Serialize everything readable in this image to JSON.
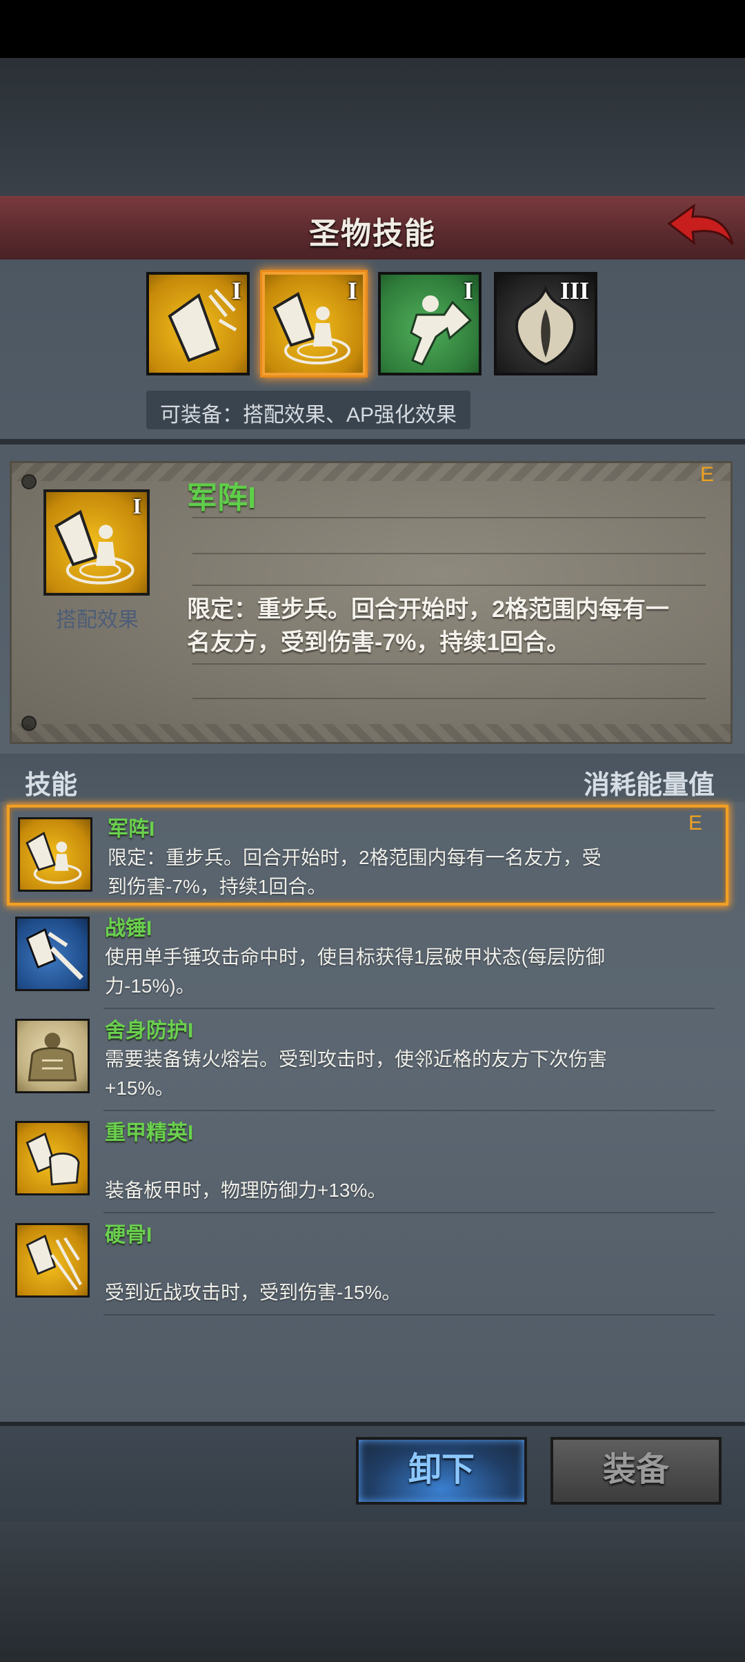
{
  "header": {
    "title": "圣物技能"
  },
  "relic_slots": [
    {
      "grade": "I",
      "color": "gold",
      "selected": false
    },
    {
      "grade": "I",
      "color": "gold",
      "selected": true
    },
    {
      "grade": "I",
      "color": "green",
      "selected": false
    },
    {
      "grade": "III",
      "color": "dark",
      "selected": false
    }
  ],
  "equip_note": "可装备：搭配效果、AP强化效果",
  "detail": {
    "grade": "I",
    "icon_label": "搭配效果",
    "title": "军阵I",
    "rank": "E",
    "description": "限定：重步兵。回合开始时，2格范围内每有一名友方，受到伤害-7%，持续1回合。"
  },
  "list_header": {
    "left": "技能",
    "right": "消耗能量值"
  },
  "skills": [
    {
      "name": "军阵I",
      "rank": "E",
      "desc": "限定：重步兵。回合开始时，2格范围内每有一名友方，受到伤害-7%，持续1回合。",
      "icon": "formation-icon",
      "color": "gold",
      "selected": true
    },
    {
      "name": "战锤I",
      "desc": "使用单手锤攻击命中时，使目标获得1层破甲状态(每层防御力-15%)。",
      "icon": "war-hammer-icon",
      "color": "blue"
    },
    {
      "name": "舍身防护I",
      "desc": "需要装备铸火熔岩。受到攻击时，使邻近格的友方下次伤害+15%。",
      "icon": "golem-icon",
      "color": "cream"
    },
    {
      "name": "重甲精英I",
      "desc": "装备板甲时，物理防御力+13%。",
      "icon": "heavy-armor-icon",
      "color": "gold"
    },
    {
      "name": "硬骨I",
      "desc": "受到近战攻击时，受到伤害-15%。",
      "icon": "hard-bone-icon",
      "color": "gold"
    }
  ],
  "buttons": {
    "unequip": "卸下",
    "equip": "装备"
  },
  "colors": {
    "accent": "#f1a024",
    "skill_name": "#6ad04e",
    "title_bar": "#6a3236"
  }
}
